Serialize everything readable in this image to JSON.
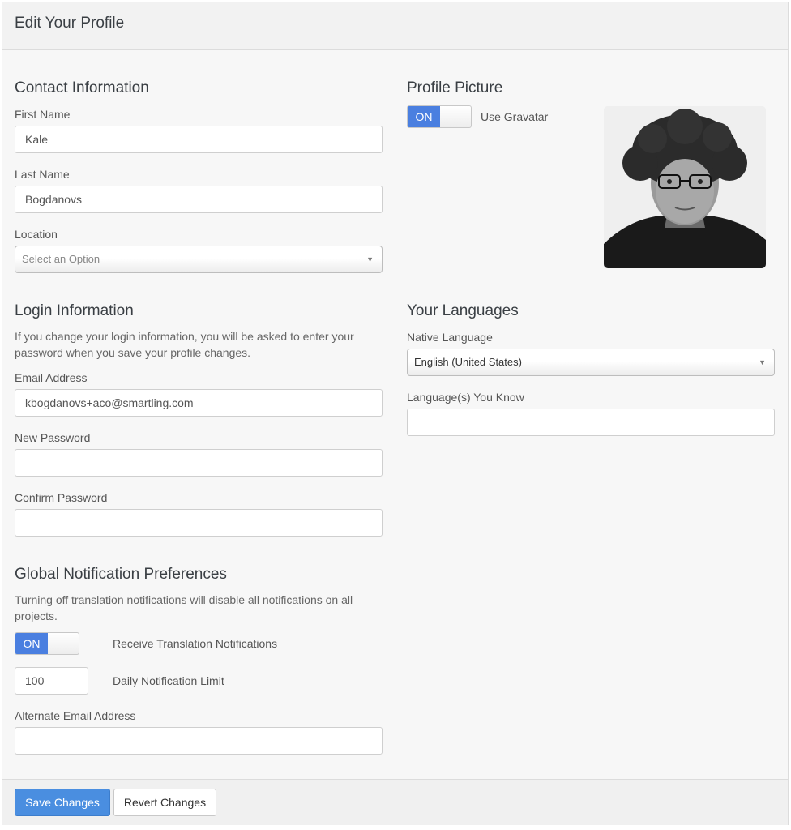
{
  "header": {
    "title": "Edit Your Profile"
  },
  "contact": {
    "title": "Contact Information",
    "first_name_label": "First Name",
    "first_name_value": "Kale",
    "last_name_label": "Last Name",
    "last_name_value": "Bogdanovs",
    "location_label": "Location",
    "location_placeholder": "Select an Option"
  },
  "profile_picture": {
    "title": "Profile Picture",
    "toggle_state": "ON",
    "toggle_label": "Use Gravatar"
  },
  "login": {
    "title": "Login Information",
    "help_line1": "If you change your login information, you will be asked to enter your",
    "help_line2": "password when you save your profile changes.",
    "email_label": "Email Address",
    "email_value": "kbogdanovs+aco@smartling.com",
    "new_password_label": "New Password",
    "confirm_password_label": "Confirm Password"
  },
  "languages": {
    "title": "Your Languages",
    "native_label": "Native Language",
    "native_value": "English (United States)",
    "known_label": "Language(s) You Know"
  },
  "notifications": {
    "title": "Global Notification Preferences",
    "help_line1": "Turning off translation notifications will disable all notifications on all",
    "help_line2": "projects.",
    "toggle_state": "ON",
    "toggle_label": "Receive Translation Notifications",
    "limit_value": "100",
    "limit_label": "Daily Notification Limit",
    "alt_email_label": "Alternate Email Address"
  },
  "footer": {
    "save_label": "Save Changes",
    "revert_label": "Revert Changes"
  }
}
